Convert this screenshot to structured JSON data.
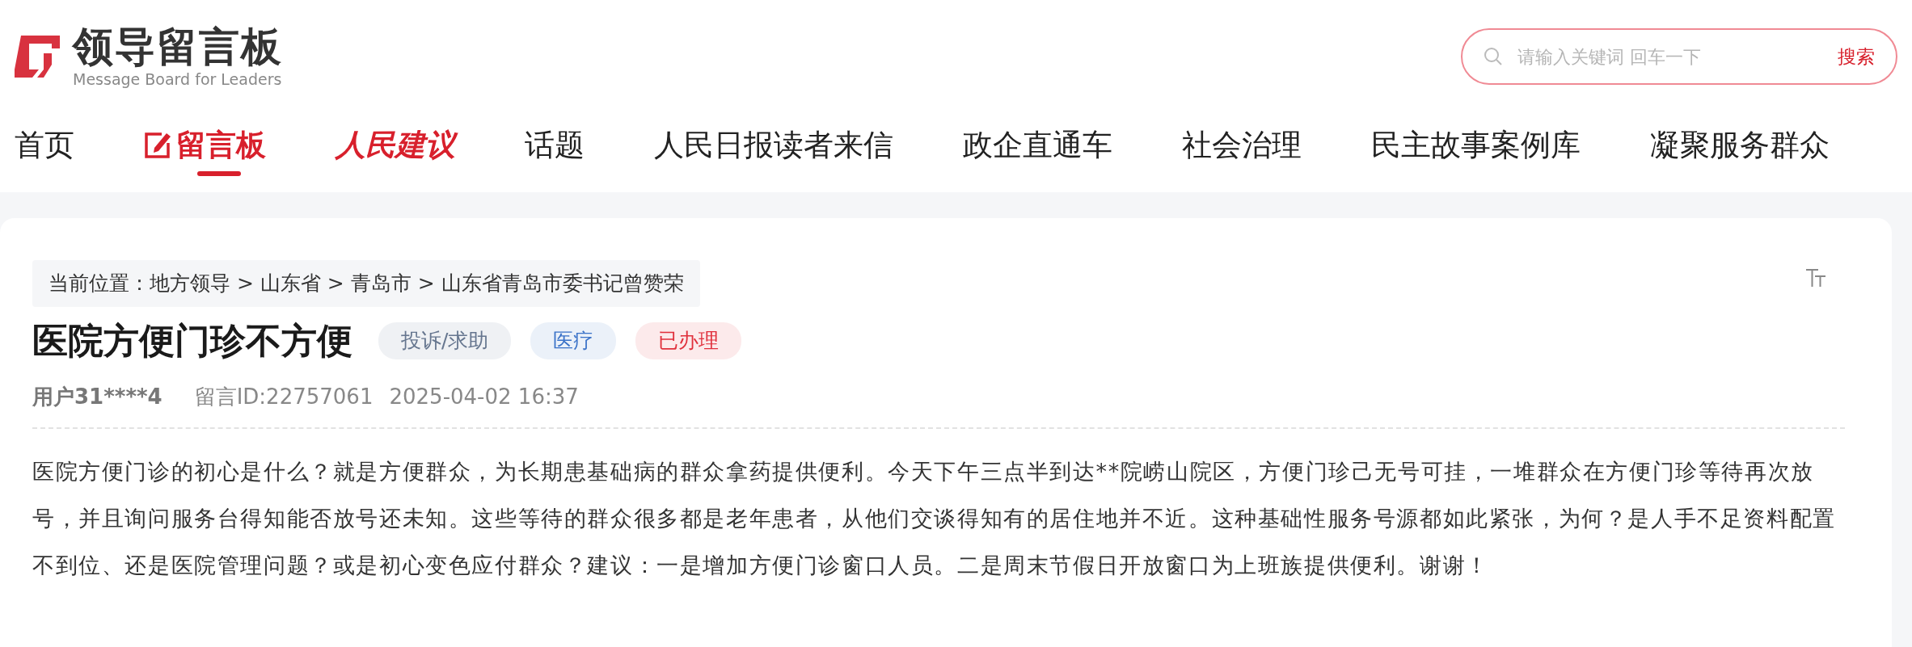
{
  "logo": {
    "title": "领导留言板",
    "subtitle": "Message Board for Leaders"
  },
  "search": {
    "placeholder": "请输入关键词 回车一下",
    "button": "搜索"
  },
  "nav": [
    {
      "label": "首页",
      "kind": "text",
      "selected": false
    },
    {
      "label": "留言板",
      "kind": "pen",
      "selected": true
    },
    {
      "label": "人民建议",
      "kind": "brush",
      "selected": false
    },
    {
      "label": "话题",
      "kind": "text",
      "selected": false
    },
    {
      "label": "人民日报读者来信",
      "kind": "text",
      "selected": false
    },
    {
      "label": "政企直通车",
      "kind": "text",
      "selected": false
    },
    {
      "label": "社会治理",
      "kind": "text",
      "selected": false
    },
    {
      "label": "民主故事案例库",
      "kind": "text",
      "selected": false
    },
    {
      "label": "凝聚服务群众",
      "kind": "text",
      "selected": false
    }
  ],
  "breadcrumb": "当前位置：地方领导 > 山东省 > 青岛市 > 山东省青岛市委书记曾赞荣",
  "title": "医院方便门珍不方便",
  "tags": [
    {
      "label": "投诉/求助",
      "color": "#66768f"
    },
    {
      "label": "医疗",
      "color": "#3a72c8"
    },
    {
      "label": "已办理",
      "color": "#e0303c"
    }
  ],
  "meta": {
    "user": "用户31****4",
    "id": "留言ID:22757061",
    "time": "2025-04-02 16:37"
  },
  "body": "医院方便门诊的初心是什么？就是方便群众，为长期患基础病的群众拿药提供便利。今天下午三点半到达**院崂山院区，方便门珍己无号可挂，一堆群众在方便门珍等待再次放号，并且询问服务台得知能否放号还未知。这些等待的群众很多都是老年患者，从他们交谈得知有的居住地并不近。这种基础性服务号源都如此紧张，为何？是人手不足资料配置不到位、还是医院管理问题？或是初心变色应付群众？建议：一是增加方便门诊窗口人员。二是周末节假日开放窗口为上班族提供便利。谢谢！"
}
